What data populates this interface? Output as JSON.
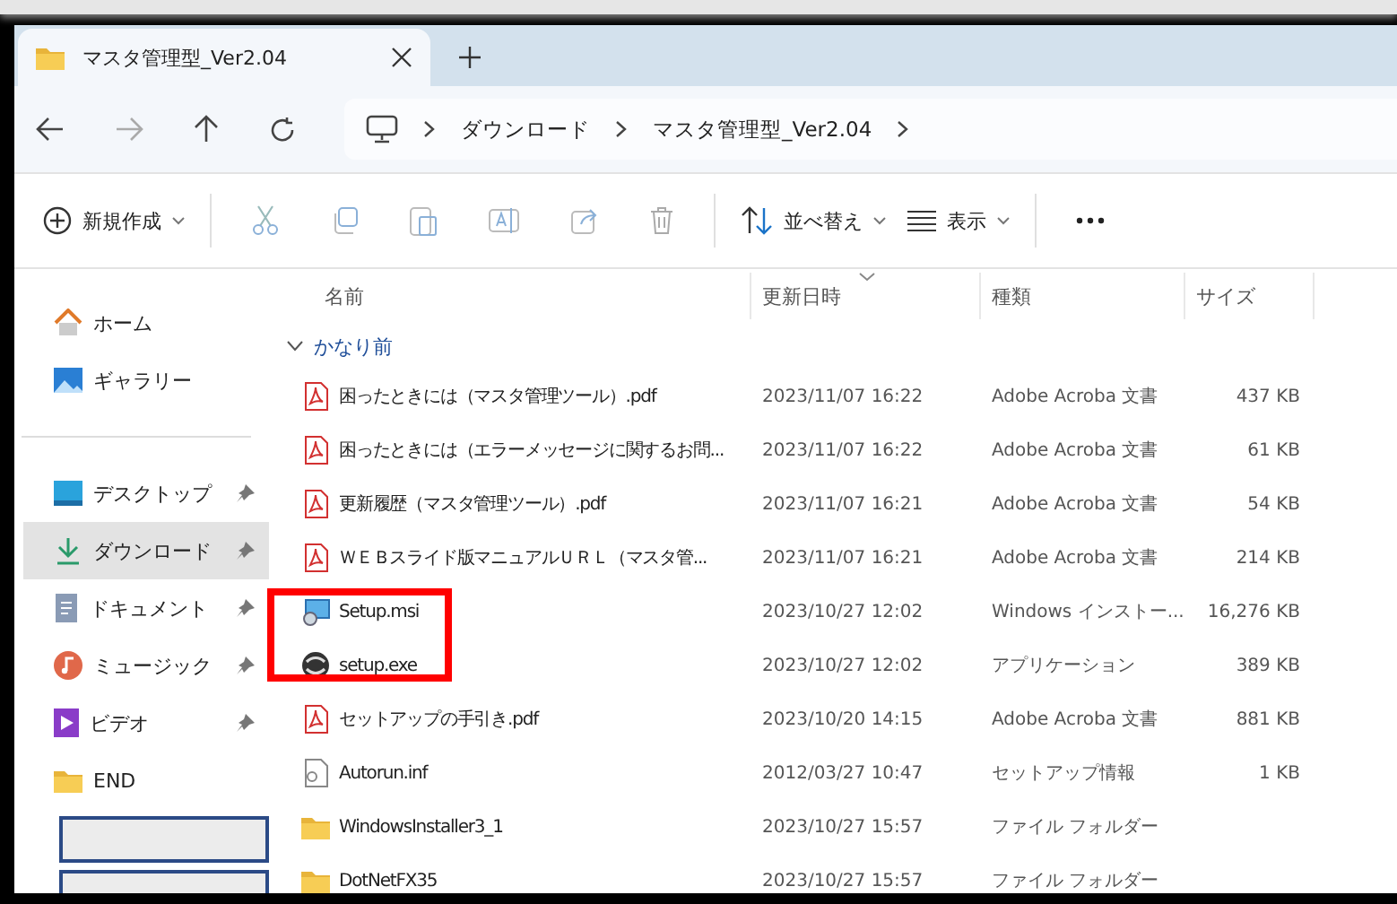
{
  "tab": {
    "title": "マスタ管理型_Ver2.04"
  },
  "breadcrumb": [
    "ダウンロード",
    "マスタ管理型_Ver2.04"
  ],
  "toolbar": {
    "new_label": "新規作成",
    "sort_label": "並べ替え",
    "view_label": "表示"
  },
  "sidebar": [
    {
      "kind": "home",
      "label": "ホーム",
      "pinned": false,
      "selected": false
    },
    {
      "kind": "gallery",
      "label": "ギャラリー",
      "pinned": false,
      "selected": false
    },
    {
      "kind": "divider"
    },
    {
      "kind": "desktop",
      "label": "デスクトップ",
      "pinned": true,
      "selected": false
    },
    {
      "kind": "download",
      "label": "ダウンロード",
      "pinned": true,
      "selected": true
    },
    {
      "kind": "documents",
      "label": "ドキュメント",
      "pinned": true,
      "selected": false
    },
    {
      "kind": "music",
      "label": "ミュージック",
      "pinned": true,
      "selected": false
    },
    {
      "kind": "video",
      "label": "ビデオ",
      "pinned": true,
      "selected": false
    },
    {
      "kind": "folder",
      "label": "END",
      "pinned": false,
      "selected": false
    },
    {
      "kind": "redacted"
    },
    {
      "kind": "redacted"
    }
  ],
  "columns": [
    {
      "label": "名前",
      "sorted": false
    },
    {
      "label": "更新日時",
      "sorted": true
    },
    {
      "label": "種類",
      "sorted": false
    },
    {
      "label": "サイズ",
      "sorted": false
    }
  ],
  "group": {
    "label": "かなり前",
    "expanded": true
  },
  "rows": [
    {
      "kind": "pdf",
      "name": "困ったときには（マスタ管理ツール）.pdf",
      "date": "2023/11/07 16:22",
      "type": "Adobe Acroba 文書",
      "size": "437 KB",
      "highlighted": false
    },
    {
      "kind": "pdf",
      "name": "困ったときには（エラーメッセージに関するお問...",
      "date": "2023/11/07 16:22",
      "type": "Adobe Acroba 文書",
      "size": "61 KB",
      "highlighted": false
    },
    {
      "kind": "pdf",
      "name": "更新履歴（マスタ管理ツール）.pdf",
      "date": "2023/11/07 16:21",
      "type": "Adobe Acroba 文書",
      "size": "54 KB",
      "highlighted": false
    },
    {
      "kind": "pdf",
      "name": "ＷＥＢスライド版マニュアルＵＲＬ（マスタ管...",
      "date": "2023/11/07 16:21",
      "type": "Adobe Acroba 文書",
      "size": "214 KB",
      "highlighted": false
    },
    {
      "kind": "msi",
      "name": "Setup.msi",
      "date": "2023/10/27 12:02",
      "type": "Windows インストー...",
      "size": "16,276 KB",
      "highlighted": true
    },
    {
      "kind": "exe",
      "name": "setup.exe",
      "date": "2023/10/27 12:02",
      "type": "アプリケーション",
      "size": "389 KB",
      "highlighted": true
    },
    {
      "kind": "pdf",
      "name": "セットアップの手引き.pdf",
      "date": "2023/10/20 14:15",
      "type": "Adobe Acroba 文書",
      "size": "881 KB",
      "highlighted": false
    },
    {
      "kind": "inf",
      "name": "Autorun.inf",
      "date": "2012/03/27 10:47",
      "type": "セットアップ情報",
      "size": "1 KB",
      "highlighted": false
    },
    {
      "kind": "folder",
      "name": "WindowsInstaller3_1",
      "date": "2023/10/27 15:57",
      "type": "ファイル フォルダー",
      "highlighted": false
    },
    {
      "kind": "folder",
      "name": "DotNetFX35",
      "date": "2023/10/27 15:57",
      "type": "ファイル フォルダー",
      "highlighted": false
    }
  ]
}
